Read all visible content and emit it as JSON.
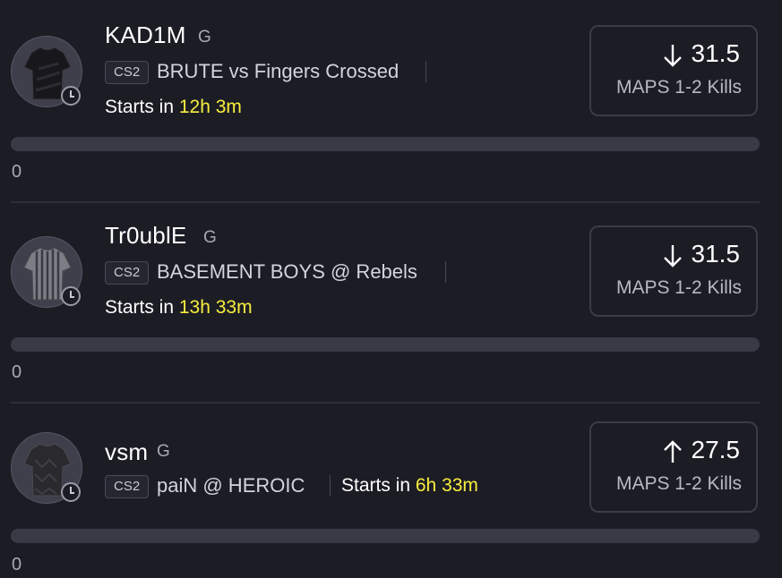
{
  "players": [
    {
      "name": "KAD1M",
      "position": "G",
      "league": "CS2",
      "matchup": "BRUTE vs Fingers Crossed",
      "starts_prefix": "Starts in",
      "starts_time": "12h 3m",
      "direction": "down",
      "direction_icon": "arrow-down-icon",
      "line": "31.5",
      "stat": "MAPS 1-2 Kills",
      "progress": 0,
      "count": "0",
      "jersey": "black-jersey"
    },
    {
      "name": "Tr0ublE",
      "position": "G",
      "league": "CS2",
      "matchup": "BASEMENT BOYS @ Rebels",
      "starts_prefix": "Starts in",
      "starts_time": "13h 33m",
      "direction": "down",
      "direction_icon": "arrow-down-icon",
      "line": "31.5",
      "stat": "MAPS 1-2 Kills",
      "progress": 0,
      "count": "0",
      "jersey": "striped-gray-jersey"
    },
    {
      "name": "vsm",
      "position": "G",
      "league": "CS2",
      "matchup": "paiN @ HEROIC",
      "starts_prefix": "Starts in",
      "starts_time": "6h 33m",
      "direction": "up",
      "direction_icon": "arrow-up-icon",
      "line": "27.5",
      "stat": "MAPS 1-2 Kills",
      "progress": 0,
      "count": "0",
      "jersey": "dark-pattern-jersey"
    }
  ],
  "colors": {
    "background": "#1c1c25",
    "highlight_time": "#f8ee3e",
    "progress_track": "#3a3a46",
    "card_border": "#3c3c48"
  }
}
